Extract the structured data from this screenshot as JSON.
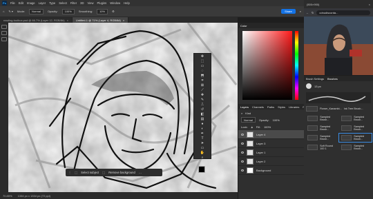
{
  "menu": [
    "File",
    "Edit",
    "Image",
    "Layer",
    "Type",
    "Select",
    "Filter",
    "3D",
    "View",
    "Plugins",
    "Window",
    "Help"
  ],
  "options": {
    "mode_label": "Mode:",
    "mode_value": "Normal",
    "opacity_label": "Opacity:",
    "opacity_value": "100%",
    "smoothing_label": "Smoothing:",
    "smoothing_value": "10%",
    "share_label": "Share"
  },
  "tabs": [
    "reading-toolbox.psd @ 66.7% (Layer 12, RGB/8#)",
    "Untitled-1 @ 71% (Layer 4, RGB/8#)"
  ],
  "context_bar": {
    "select_subject": "Select subject",
    "remove_background": "Remove background"
  },
  "status": {
    "zoom": "70.85%",
    "doc": "1334 px x 1334 px (72 ppi)"
  },
  "right_panel": {
    "color_tab": "Color",
    "layers_tabs": [
      "Layers",
      "Channels",
      "Paths",
      "Styles",
      "Libraries",
      "Properties"
    ],
    "kind_label": "Kind",
    "blend_mode": "Normal",
    "opacity_label": "Opacity:",
    "opacity_value": "100%",
    "lock_label": "Lock:",
    "fill_label": "Fill:",
    "fill_value": "100%",
    "layers": [
      "Layer 4",
      "Layer 3",
      "Layer 1",
      "Layer 2",
      "Background"
    ]
  },
  "browser": {
    "tab_title": "(500×900)",
    "url": "cdnudiscorda...",
    "brushes_tabs": [
      "Brush Settings",
      "Brushes"
    ],
    "size_value": "13 px",
    "brush_groups": [
      "Sampled Brush...",
      "Sampled Brush...",
      "Sampled Brush...",
      "Sampled Brush...",
      "Sampled Brush...",
      "Sampled Brush...",
      "Soft Round 100 1",
      "Sampled Brush..."
    ],
    "brush_names": [
      "Flower_Kanambi...",
      "Ink Tree Brush..."
    ]
  },
  "colors": {
    "accent": "#1473e6",
    "panel": "#2f2f2f",
    "menubar": "#323232"
  },
  "icons": [
    "move-icon",
    "marquee-icon",
    "lasso-icon",
    "brush-icon",
    "eraser-icon",
    "gradient-icon",
    "pen-icon",
    "type-icon",
    "hand-icon",
    "zoom-icon",
    "eye-icon",
    "lock-icon",
    "search-icon",
    "back-icon",
    "refresh-icon"
  ]
}
